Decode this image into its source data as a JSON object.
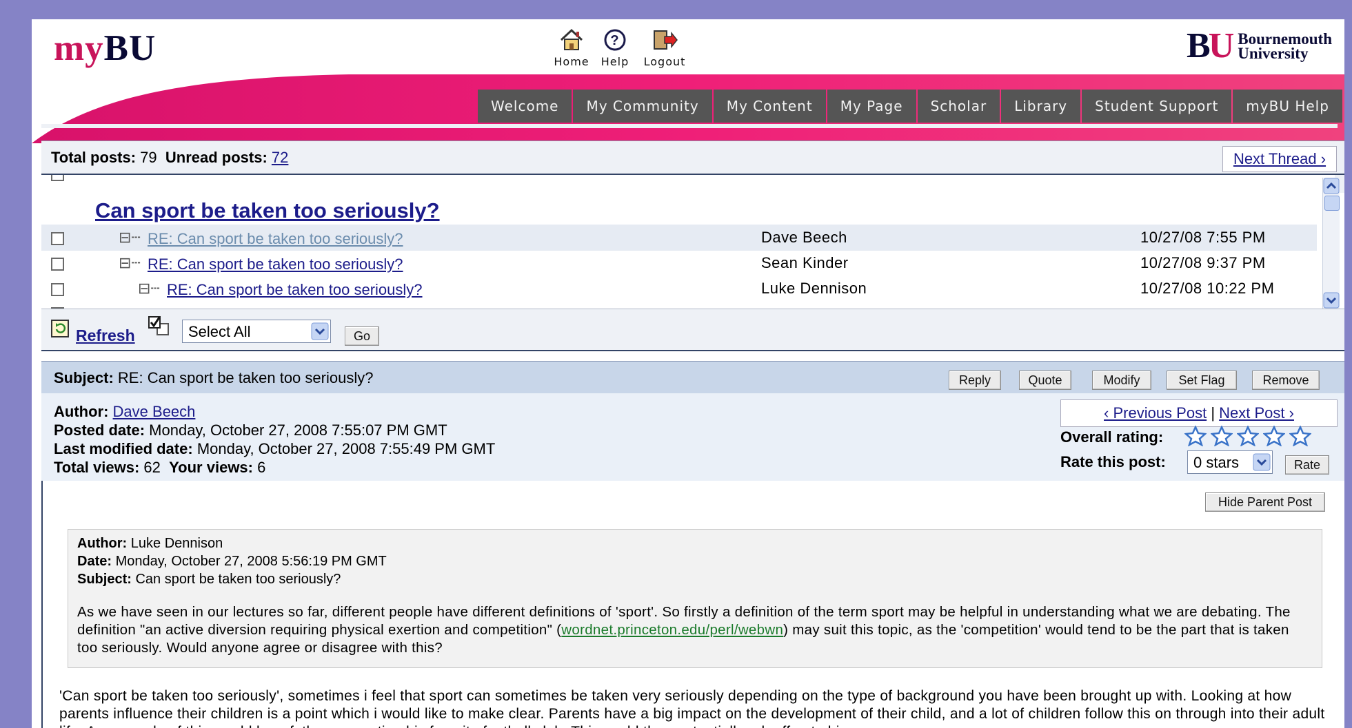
{
  "header": {
    "logo_my": "my",
    "logo_bu": "BU",
    "icons": [
      {
        "name": "home-icon",
        "label": "Home"
      },
      {
        "name": "help-icon",
        "label": "Help"
      },
      {
        "name": "logout-icon",
        "label": "Logout"
      }
    ],
    "brand_mark_b": "B",
    "brand_mark_u": "U",
    "brand_name_line1": "Bournemouth",
    "brand_name_line2": "University"
  },
  "nav": {
    "tabs": [
      "Welcome",
      "My Community",
      "My Content",
      "My Page",
      "Scholar",
      "Library",
      "Student Support",
      "myBU Help"
    ]
  },
  "thread_bar": {
    "total_posts_label": "Total posts:",
    "total_posts": "79",
    "unread_posts_label": "Unread posts:",
    "unread_posts": "72",
    "next_thread": "Next Thread ›"
  },
  "thread": {
    "title": "Can sport be taken too seriously?",
    "expand_glyph": "⊟",
    "posts": [
      {
        "subject": "RE: Can sport be taken too seriously?",
        "author": "Dave Beech",
        "date": "10/27/08 7:55 PM"
      },
      {
        "subject": "RE: Can sport be taken too seriously?",
        "author": "Sean Kinder",
        "date": "10/27/08 9:37 PM"
      },
      {
        "subject": "RE: Can sport be taken too seriously?",
        "author": "Luke Dennison",
        "date": "10/27/08 10:22 PM"
      }
    ]
  },
  "toolbar": {
    "refresh": "Refresh",
    "select_value": "Select All",
    "go": "Go"
  },
  "post": {
    "subject_label": "Subject:",
    "subject": "RE: Can sport be taken too seriously?",
    "actions": [
      "Reply",
      "Quote",
      "Modify",
      "Set Flag",
      "Remove"
    ],
    "author_label": "Author:",
    "author": "Dave Beech",
    "posted_label": "Posted date:",
    "posted": "Monday, October 27, 2008 7:55:07 PM GMT",
    "modified_label": "Last modified date:",
    "modified": "Monday, October 27, 2008 7:55:49 PM GMT",
    "total_views_label": "Total views:",
    "total_views": "62",
    "your_views_label": "Your views:",
    "your_views": "6",
    "prev_post": "‹ Previous Post",
    "pipe": "|",
    "next_post": "Next Post ›",
    "overall_rating_label": "Overall rating:",
    "rating_stars": 0,
    "rate_label": "Rate this post:",
    "rate_value": "0 stars",
    "rate_button": "Rate",
    "hide_parent": "Hide Parent Post"
  },
  "parent_post": {
    "author_label": "Author:",
    "author": "Luke Dennison",
    "date_label": "Date:",
    "date": "Monday, October 27, 2008 5:56:19 PM GMT",
    "subject_label": "Subject:",
    "subject": "Can sport be taken too seriously?",
    "body_before": "As we have seen in our lectures so far, different people have different definitions of 'sport'. So firstly a definition of the term sport may be helpful in understanding what we are debating. The definition \"an active diversion requiring physical exertion and competition\" (",
    "body_link": "wordnet.princeton.edu/perl/webwn",
    "body_after": ") may suit this topic, as the 'competition' would tend to be the part that is taken too seriously. Would anyone agree or disagree with this?"
  },
  "reply_body": "'Can sport be taken too seriously', sometimes i feel that sport can sometimes be taken very seriously depending on the type of background you have been brought up with. Looking at how parents influence their children is a point which i would like to make clear. Parents have a big impact on the development of their child, and a lot of children follow this on through into their adult life. An example of this would be a father supporting his favorite football club. This could then potentially rub off onto his",
  "colors": {
    "brand_pink": "#e5186f",
    "nav_gray": "#555555",
    "post_header_bg": "#c8d6e9",
    "link": "#1c1c8a"
  }
}
